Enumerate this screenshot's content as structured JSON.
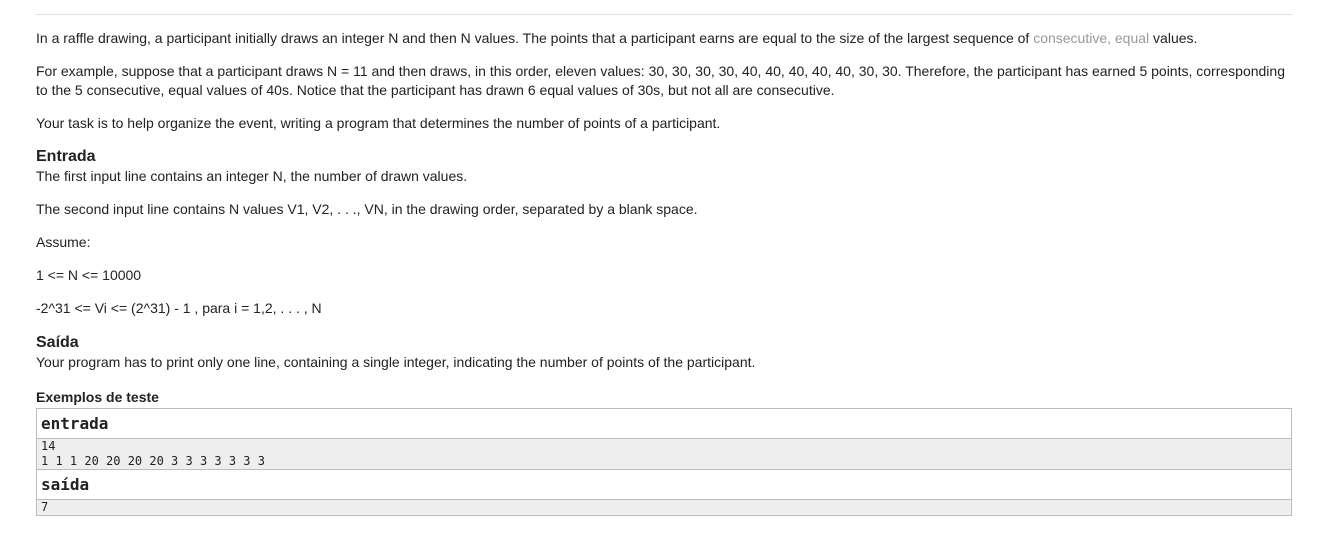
{
  "intro": {
    "p1_before": "In a raffle drawing, a participant initially draws an integer N and then N values. The points that a participant earns are equal to the size of the largest sequence of ",
    "p1_highlight": "consecutive, equal",
    "p1_after": " values.",
    "p2": "For example, suppose that a participant draws N = 11 and then draws, in this order, eleven values: 30, 30, 30, 30, 40, 40, 40, 40, 40, 30, 30. Therefore, the participant has earned 5 points, corresponding to the 5 consecutive, equal values of 40s. Notice that the participant has drawn 6 equal values of 30s, but not all are consecutive.",
    "p3": "Your task is to help organize the event, writing a program that determines the number of points of a participant."
  },
  "entrada": {
    "title": "Entrada",
    "line1": "The first input line contains an integer N, the number of drawn values.",
    "line2": "The second input line contains N values V1, V2, . . ., VN, in the drawing order, separated by a blank space.",
    "line3": "Assume:",
    "line4": "1 <= N <= 10000",
    "line5": "-2^31 <= Vi <= (2^31) - 1 , para i = 1,2, . . . , N"
  },
  "saida": {
    "title": "Saída",
    "line1": "Your program has to print only one line, containing a single integer, indicating the number of points of the participant."
  },
  "examples": {
    "title": "Exemplos de teste",
    "input_header": "entrada",
    "input_body": "14\n1 1 1 20 20 20 20 3 3 3 3 3 3 3",
    "output_header": "saída",
    "output_body": "7"
  }
}
